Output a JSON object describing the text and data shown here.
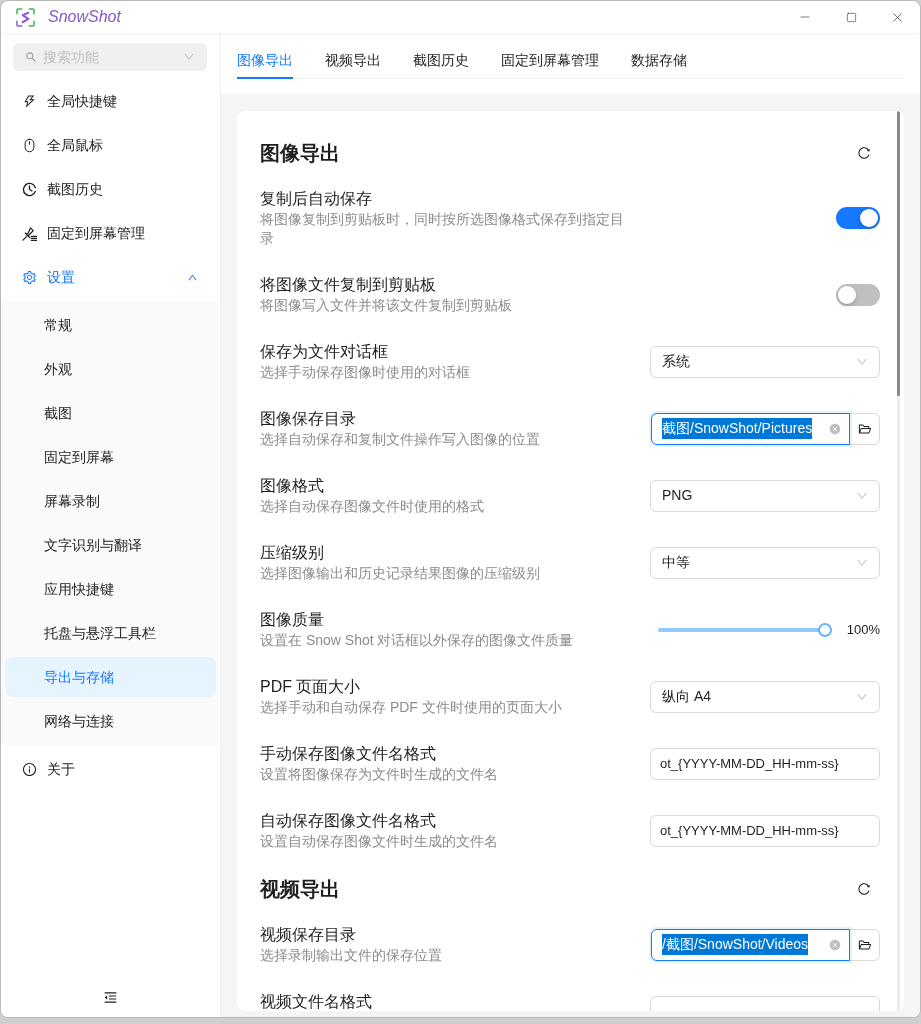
{
  "window": {
    "title": "SnowShot"
  },
  "sidebar": {
    "search": {
      "placeholder": "搜索功能"
    },
    "items": [
      {
        "label": "全局快捷键",
        "selected": false
      },
      {
        "label": "全局鼠标",
        "selected": false
      },
      {
        "label": "截图历史",
        "selected": false
      },
      {
        "label": "固定到屏幕管理",
        "selected": false
      },
      {
        "label": "设置",
        "selected": false,
        "expanded": true,
        "children": [
          {
            "label": "常规",
            "selected": false
          },
          {
            "label": "外观",
            "selected": false
          },
          {
            "label": "截图",
            "selected": false
          },
          {
            "label": "固定到屏幕",
            "selected": false
          },
          {
            "label": "屏幕录制",
            "selected": false
          },
          {
            "label": "文字识别与翻译",
            "selected": false
          },
          {
            "label": "应用快捷键",
            "selected": false
          },
          {
            "label": "托盘与悬浮工具栏",
            "selected": false
          },
          {
            "label": "导出与存储",
            "selected": true
          },
          {
            "label": "网络与连接",
            "selected": false
          }
        ]
      },
      {
        "label": "关于",
        "selected": false
      }
    ]
  },
  "tabs": [
    {
      "label": "图像导出",
      "selected": true
    },
    {
      "label": "视频导出",
      "selected": false
    },
    {
      "label": "截图历史",
      "selected": false
    },
    {
      "label": "固定到屏幕管理",
      "selected": false
    },
    {
      "label": "数据存储",
      "selected": false
    }
  ],
  "sections": [
    {
      "title": "图像导出",
      "rows": [
        {
          "kind": "toggle",
          "label": "复制后自动保存",
          "description": "将图像复制到剪贴板时，同时按所选图像格式保存到指定目录",
          "on": true
        },
        {
          "kind": "toggle",
          "label": "将图像文件复制到剪贴板",
          "description": "将图像写入文件并将该文件复制到剪贴板",
          "on": false
        },
        {
          "kind": "select",
          "label": "保存为文件对话框",
          "description": "选择手动保存图像时使用的对话框",
          "value": "系统"
        },
        {
          "kind": "path",
          "label": "图像保存目录",
          "description": "选择自动保存和复制文件操作写入图像的位置",
          "value": "截图/SnowShot/Pictures",
          "focused": true
        },
        {
          "kind": "select",
          "label": "图像格式",
          "description": "选择自动保存图像文件时使用的格式",
          "value": "PNG"
        },
        {
          "kind": "select",
          "label": "压缩级别",
          "description": "选择图像输出和历史记录结果图像的压缩级别",
          "value": "中等"
        },
        {
          "kind": "slider",
          "label": "图像质量",
          "description": "设置在 Snow Shot 对话框以外保存的图像文件质量",
          "level": 1,
          "reading": "100%"
        },
        {
          "kind": "select",
          "label": "PDF 页面大小",
          "description": "选择手动和自动保存 PDF 文件时使用的页面大小",
          "value": "纵向 A4"
        },
        {
          "kind": "text",
          "label": "手动保存图像文件名格式",
          "description": "设置将图像保存为文件时生成的文件名",
          "value": "ot_{YYYY-MM-DD_HH-mm-ss}"
        },
        {
          "kind": "text",
          "label": "自动保存图像文件名格式",
          "description": "设置自动保存图像文件时生成的文件名",
          "value": "ot_{YYYY-MM-DD_HH-mm-ss}"
        }
      ]
    },
    {
      "title": "视频导出",
      "rows": [
        {
          "kind": "path",
          "label": "视频保存目录",
          "description": "选择录制输出文件的保存位置",
          "value": "/截图/SnowShot/Videos",
          "focused": true
        },
        {
          "kind": "text",
          "label": "视频文件名格式"
        }
      ]
    }
  ]
}
